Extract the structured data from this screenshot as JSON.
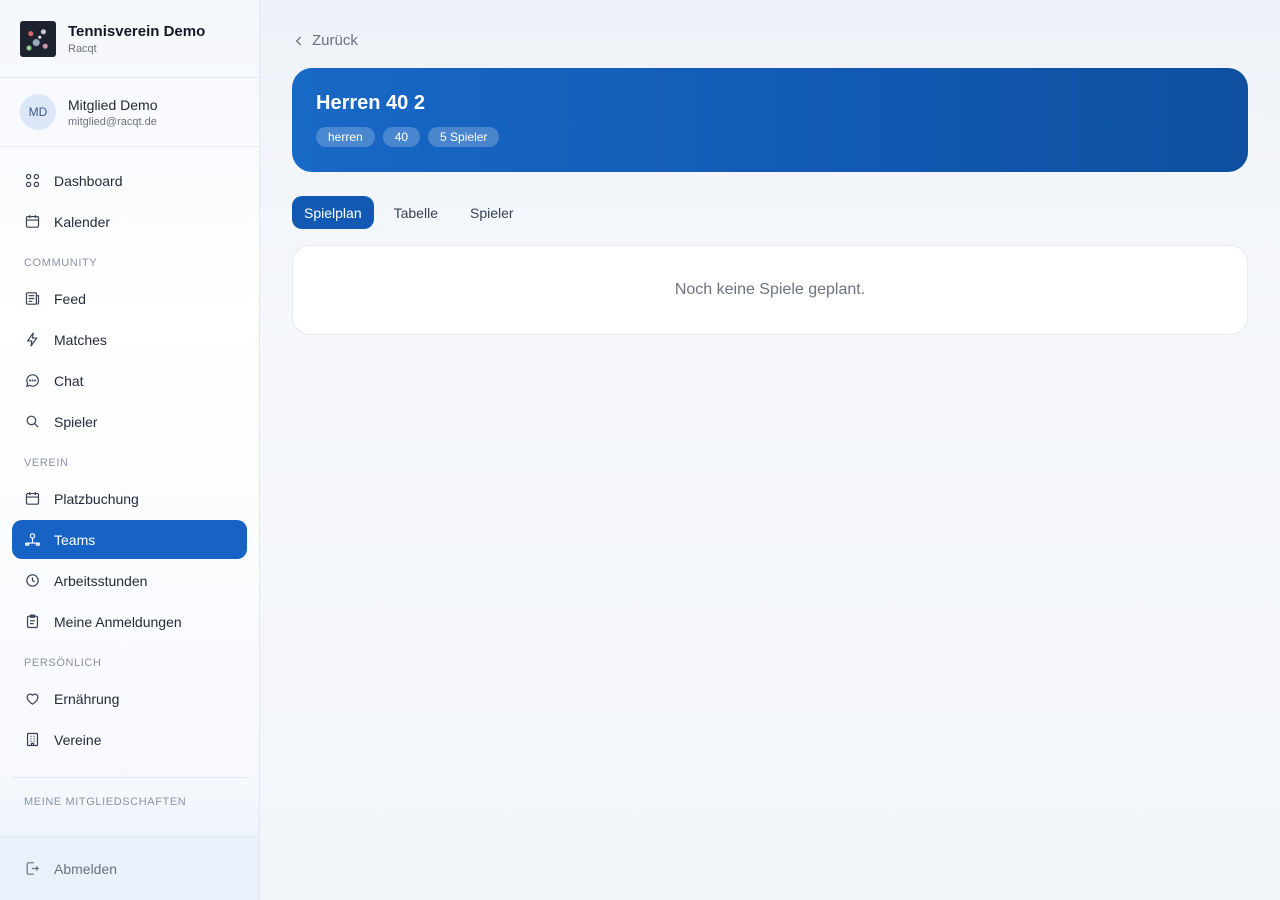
{
  "brand": {
    "title": "Tennisverein Demo",
    "subtitle": "Racqt"
  },
  "user": {
    "initials": "MD",
    "name": "Mitglied Demo",
    "email": "mitglied@racqt.de"
  },
  "nav": {
    "dashboard": "Dashboard",
    "kalender": "Kalender",
    "community_label": "COMMUNITY",
    "feed": "Feed",
    "matches": "Matches",
    "chat": "Chat",
    "spieler": "Spieler",
    "verein_label": "VEREIN",
    "platzbuchung": "Platzbuchung",
    "teams": "Teams",
    "arbeitsstunden": "Arbeitsstunden",
    "anmeldungen": "Meine Anmeldungen",
    "persoenlich_label": "PERSÖNLICH",
    "ernaehrung": "Ernährung",
    "vereine": "Vereine",
    "mitgliedschaften_label": "MEINE MITGLIEDSCHAFTEN",
    "logout": "Abmelden"
  },
  "main": {
    "back_label": "Zurück",
    "team_title": "Herren 40 2",
    "tags": [
      "herren",
      "40",
      "5 Spieler"
    ],
    "tabs": [
      "Spielplan",
      "Tabelle",
      "Spieler"
    ],
    "empty_message": "Noch keine Spiele geplant."
  },
  "colors": {
    "accent": "#1763c5",
    "hero_start": "#1868c6",
    "hero_end": "#0e4f9f"
  }
}
